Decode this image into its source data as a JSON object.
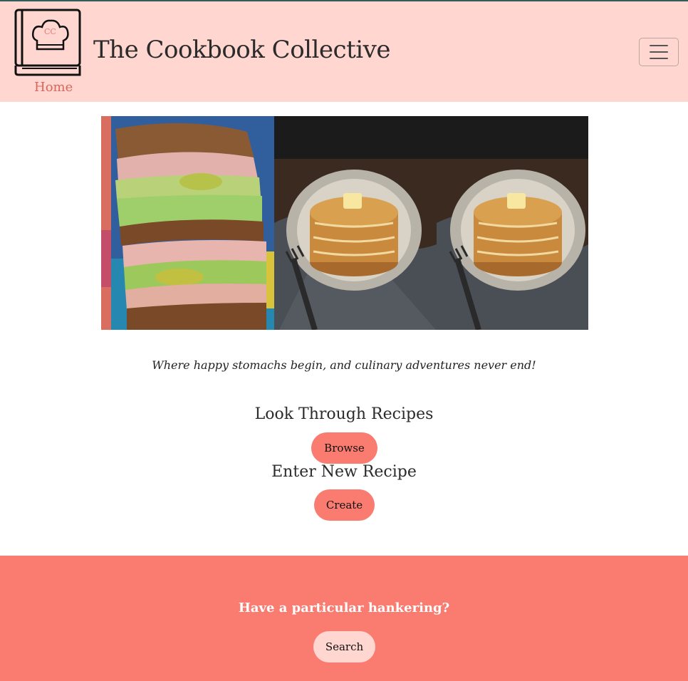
{
  "header": {
    "logo_initials": "CC",
    "home_label": "Home",
    "site_title": "The Cookbook Collective",
    "menu_icon": "hamburger-menu-icon"
  },
  "hero": {
    "slides": [
      "sandwich",
      "pancakes",
      "pancakes"
    ]
  },
  "main": {
    "tagline": "Where happy stomachs begin, and culinary adventures never end!",
    "browse_heading": "Look Through Recipes",
    "browse_button": "Browse",
    "create_heading": "Enter New Recipe",
    "create_button": "Create"
  },
  "search_band": {
    "heading": "Have a particular hankering?",
    "search_button": "Search"
  },
  "colors": {
    "header_bg": "#ffd6d0",
    "accent": "#fa7b70",
    "home_link": "#d9675c"
  }
}
